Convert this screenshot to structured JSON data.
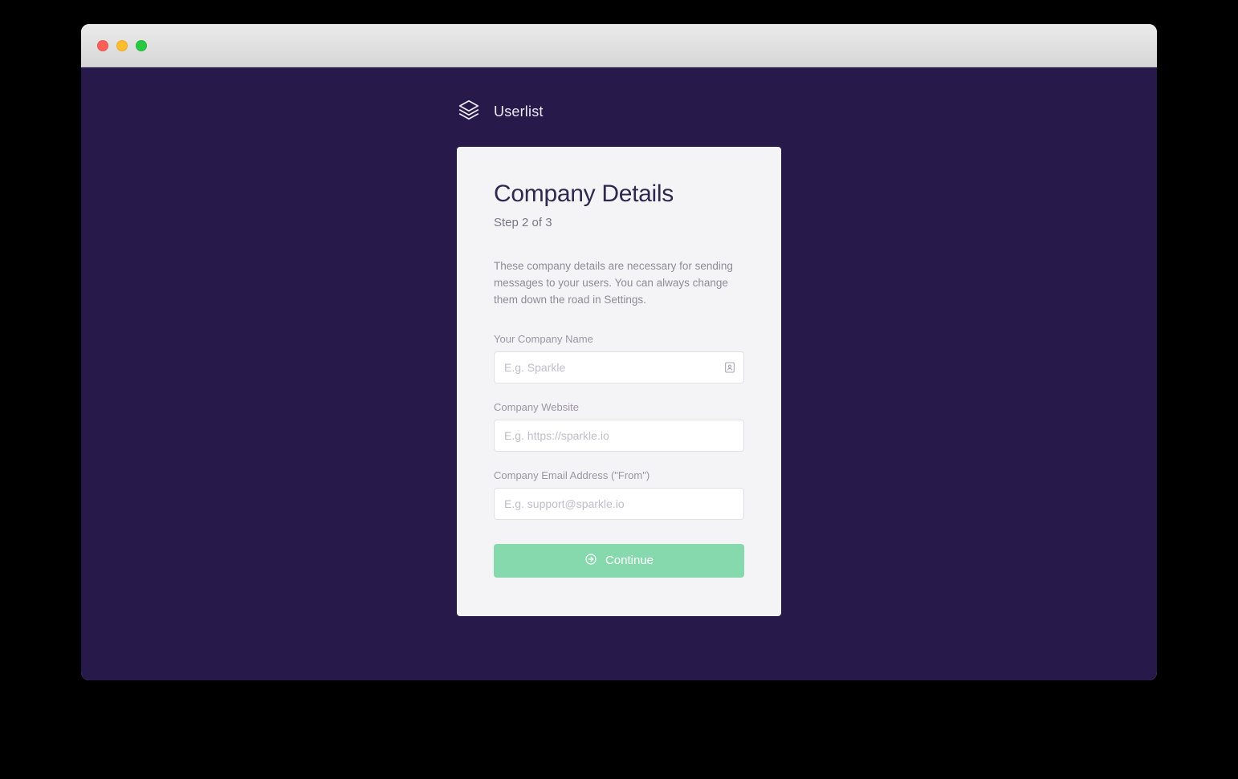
{
  "brand": {
    "name": "Userlist"
  },
  "card": {
    "title": "Company Details",
    "step_label": "Step 2 of 3",
    "description": "These company details are necessary for sending messages to your users. You can always change them down the road in Settings.",
    "fields": {
      "company_name": {
        "label": "Your Company Name",
        "placeholder": "E.g. Sparkle",
        "value": ""
      },
      "company_website": {
        "label": "Company Website",
        "placeholder": "E.g. https://sparkle.io",
        "value": ""
      },
      "company_email": {
        "label": "Company Email Address (\"From\")",
        "placeholder": "E.g. support@sparkle.io",
        "value": ""
      }
    },
    "submit_label": "Continue"
  },
  "colors": {
    "bg": "#271949",
    "accent": "#86d9ad",
    "card": "#f4f3f6",
    "text_heading": "#2f2950"
  }
}
